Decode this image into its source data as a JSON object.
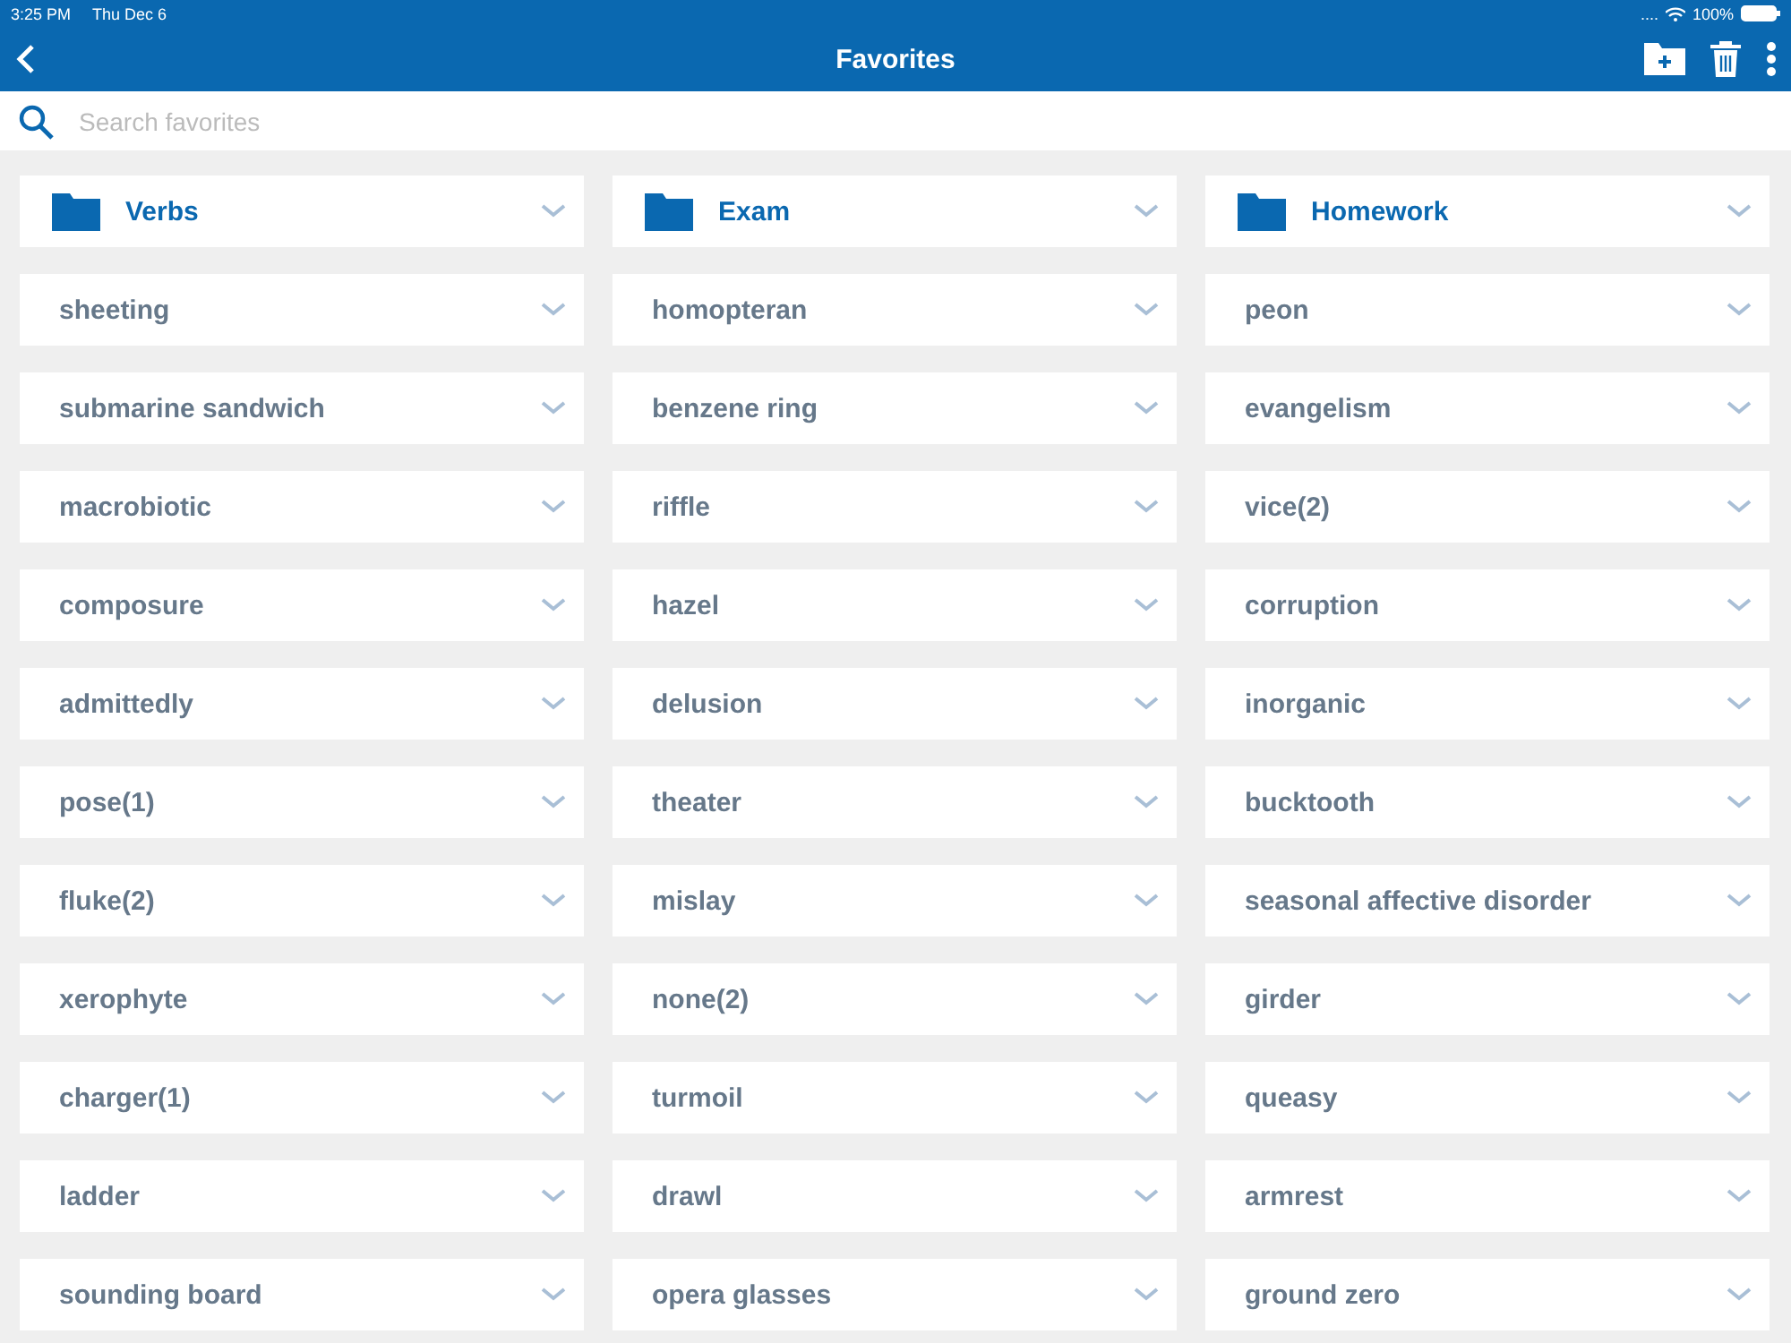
{
  "status_bar": {
    "time": "3:25 PM",
    "date": "Thu Dec 6",
    "signal": "....",
    "battery": "100%"
  },
  "nav_bar": {
    "title": "Favorites"
  },
  "search": {
    "placeholder": "Search favorites"
  },
  "items": [
    {
      "kind": "folder",
      "label": "Verbs"
    },
    {
      "kind": "folder",
      "label": "Exam"
    },
    {
      "kind": "folder",
      "label": "Homework"
    },
    {
      "kind": "word",
      "label": "sheeting"
    },
    {
      "kind": "word",
      "label": "homopteran"
    },
    {
      "kind": "word",
      "label": "peon"
    },
    {
      "kind": "word",
      "label": "submarine sandwich"
    },
    {
      "kind": "word",
      "label": "benzene ring"
    },
    {
      "kind": "word",
      "label": "evangelism"
    },
    {
      "kind": "word",
      "label": "macrobiotic"
    },
    {
      "kind": "word",
      "label": "riffle"
    },
    {
      "kind": "word",
      "label": "vice(2)"
    },
    {
      "kind": "word",
      "label": "composure"
    },
    {
      "kind": "word",
      "label": "hazel"
    },
    {
      "kind": "word",
      "label": "corruption"
    },
    {
      "kind": "word",
      "label": "admittedly"
    },
    {
      "kind": "word",
      "label": "delusion"
    },
    {
      "kind": "word",
      "label": "inorganic"
    },
    {
      "kind": "word",
      "label": "pose(1)"
    },
    {
      "kind": "word",
      "label": "theater"
    },
    {
      "kind": "word",
      "label": "bucktooth"
    },
    {
      "kind": "word",
      "label": "fluke(2)"
    },
    {
      "kind": "word",
      "label": "mislay"
    },
    {
      "kind": "word",
      "label": "seasonal affective disorder"
    },
    {
      "kind": "word",
      "label": "xerophyte"
    },
    {
      "kind": "word",
      "label": "none(2)"
    },
    {
      "kind": "word",
      "label": "girder"
    },
    {
      "kind": "word",
      "label": "charger(1)"
    },
    {
      "kind": "word",
      "label": "turmoil"
    },
    {
      "kind": "word",
      "label": "queasy"
    },
    {
      "kind": "word",
      "label": "ladder"
    },
    {
      "kind": "word",
      "label": "drawl"
    },
    {
      "kind": "word",
      "label": "armrest"
    },
    {
      "kind": "word",
      "label": "sounding board"
    },
    {
      "kind": "word",
      "label": "opera glasses"
    },
    {
      "kind": "word",
      "label": "ground zero"
    }
  ]
}
